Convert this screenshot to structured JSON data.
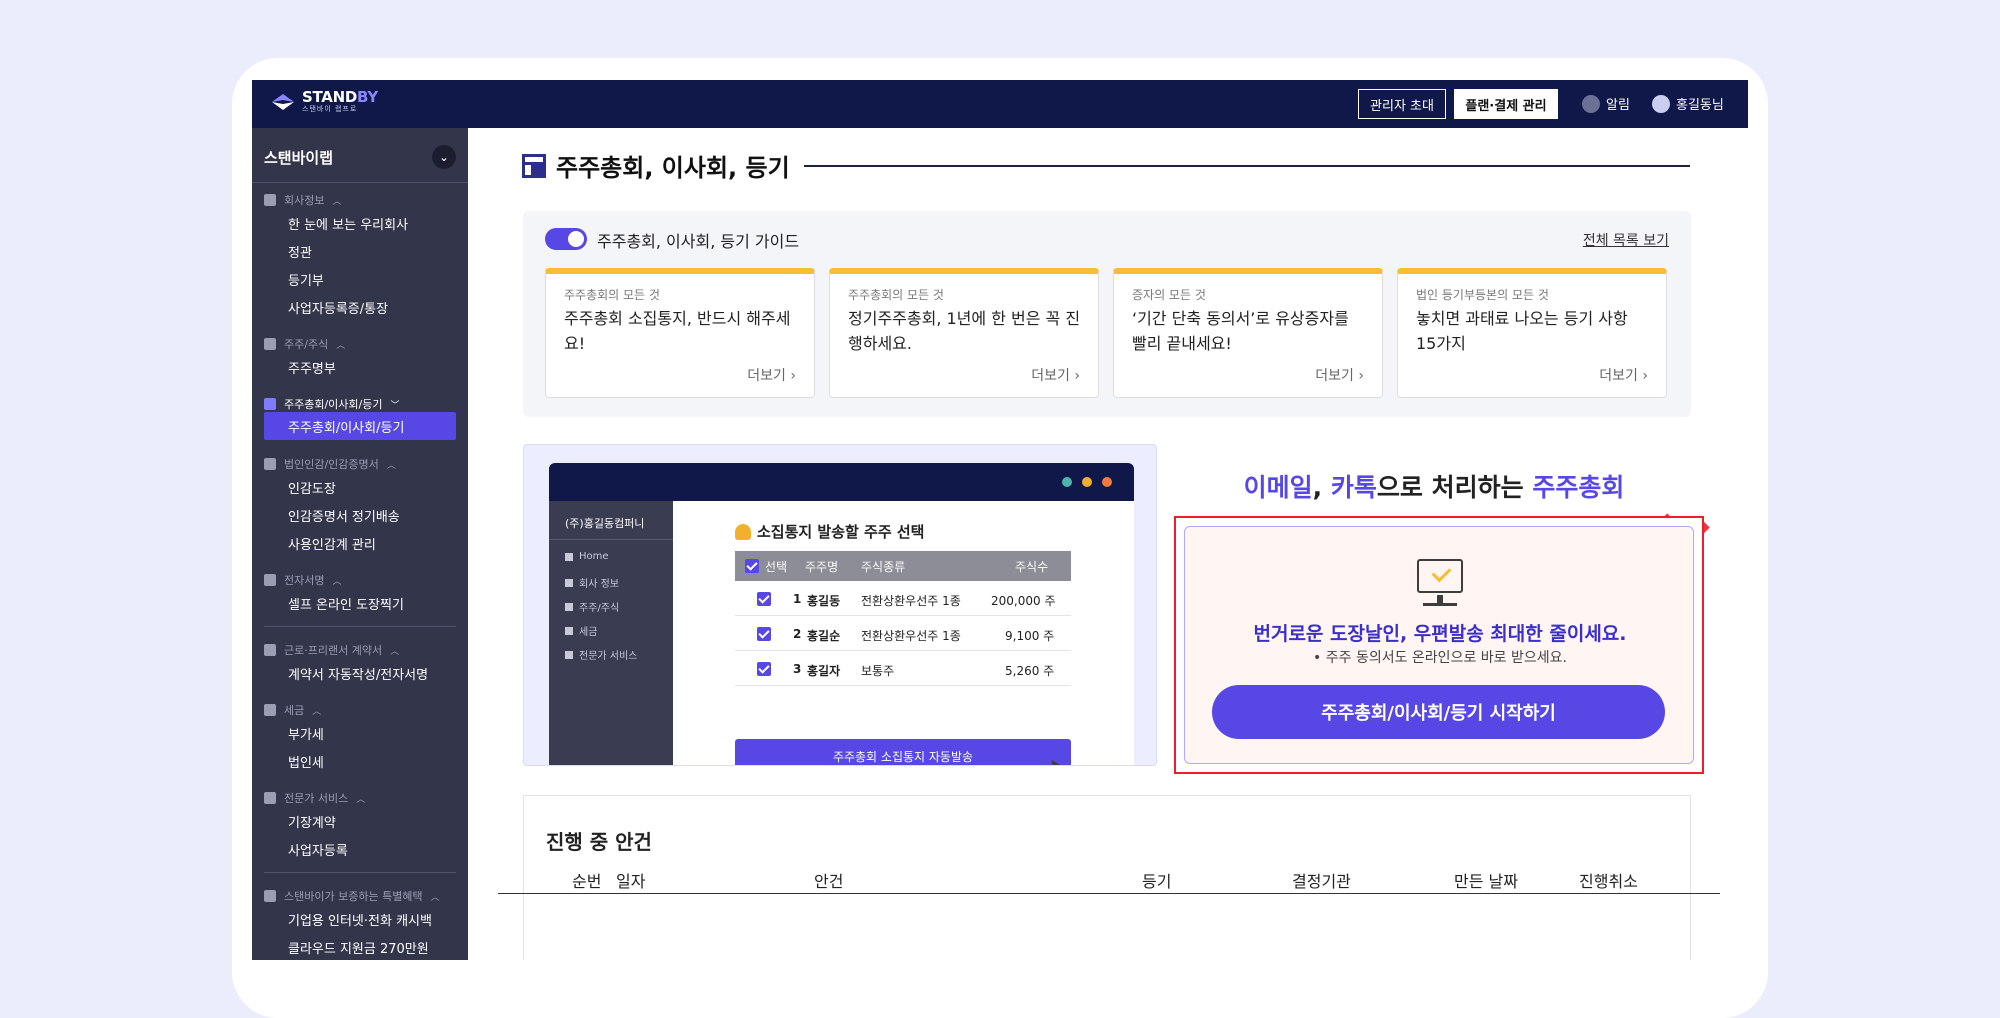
{
  "header": {
    "logo_text": "STAND",
    "logo_text_accent": "BY",
    "logo_sub": "스탠바이 랩프로",
    "invite_admin": "관리자 초대",
    "plan_billing": "플랜·결제 관리",
    "notifications": "알림",
    "user": "홍길동님"
  },
  "sidebar": {
    "company": "스탠바이랩",
    "sections": [
      {
        "title": "회사정보",
        "items": [
          "한 눈에 보는 우리회사",
          "정관",
          "등기부",
          "사업자등록증/통장"
        ]
      },
      {
        "title": "주주/주식",
        "items": [
          "주주명부"
        ]
      },
      {
        "title": "주주총회/이사회/등기",
        "items": [
          "주주총회/이사회/등기"
        ]
      },
      {
        "title": "법인인감/인감증명서",
        "items": [
          "인감도장",
          "인감증명서 정기배송",
          "사용인감계 관리"
        ]
      },
      {
        "title": "전자서명",
        "items": [
          "셀프 온라인 도장찍기"
        ]
      },
      {
        "title": "근로·프리랜서 계약서",
        "items": [
          "계약서 자동작성/전자서명"
        ]
      },
      {
        "title": "세금",
        "items": [
          "부가세",
          "법인세"
        ]
      },
      {
        "title": "전문가 서비스",
        "items": [
          "기장계약",
          "사업자등록"
        ]
      },
      {
        "title": "스탠바이가 보증하는 특별혜택",
        "items": [
          "기업용 인터넷·전화 캐시백",
          "클라우드 지원금 270만원"
        ]
      }
    ]
  },
  "page": {
    "title": "주주총회, 이사회, 등기"
  },
  "guide": {
    "title": "주주총회, 이사회, 등기 가이드",
    "view_all": "전체 목록 보기",
    "more": "더보기",
    "cards": [
      {
        "category": "주주총회의 모든 것",
        "title": "주주총회 소집통지, 반드시 해주세요!"
      },
      {
        "category": "주주총회의 모든 것",
        "title": "정기주주총회, 1년에 한 번은 꼭 진행하세요."
      },
      {
        "category": "증자의 모든 것",
        "title": "‘기간 단축 동의서’로 유상증자를 빨리 끝내세요!"
      },
      {
        "category": "법인 등기부등본의 모든 것",
        "title": "놓치면 과태료 나오는 등기 사항 15가지"
      }
    ]
  },
  "mock": {
    "company": "(주)홍길동컴퍼니",
    "nav": [
      "Home",
      "회사 정보",
      "주주/주식",
      "세금",
      "전문가 서비스"
    ],
    "heading": "소집통지 발송할 주주 선택",
    "columns": [
      "선택",
      "주주명",
      "주식종류",
      "주식수"
    ],
    "rows": [
      {
        "no": "1",
        "name": "홍길동",
        "type": "전환상환우선주 1종",
        "shares": "200,000 주"
      },
      {
        "no": "2",
        "name": "홍길순",
        "type": "전환상환우선주 1종",
        "shares": "9,100 주"
      },
      {
        "no": "3",
        "name": "홍길자",
        "type": "보통주",
        "shares": "5,260 주"
      }
    ],
    "button": "주주총회 소집통지 자동발송"
  },
  "promo": {
    "head_part1": "이메일",
    "head_part2": ", ",
    "head_part3": "카톡",
    "head_part4": "으로 처리하는 ",
    "head_part5": "주주총회",
    "main": "번거로운 도장날인, 우편발송 최대한 줄이세요.",
    "sub": "• 주주 동의서도 온라인으로 바로 받으세요.",
    "button": "주주총회/이사회/등기 시작하기"
  },
  "progress": {
    "title": "진행 중 안건",
    "columns": [
      "순번",
      "일자",
      "안건",
      "등기",
      "결정기관",
      "만든 날짜",
      "진행취소"
    ]
  },
  "colors": {
    "navy": "#0f1848",
    "accent": "#5748e6",
    "sidebar": "#33354b",
    "card_top": "#f7bd33",
    "alert_red": "#ef1d2c"
  }
}
